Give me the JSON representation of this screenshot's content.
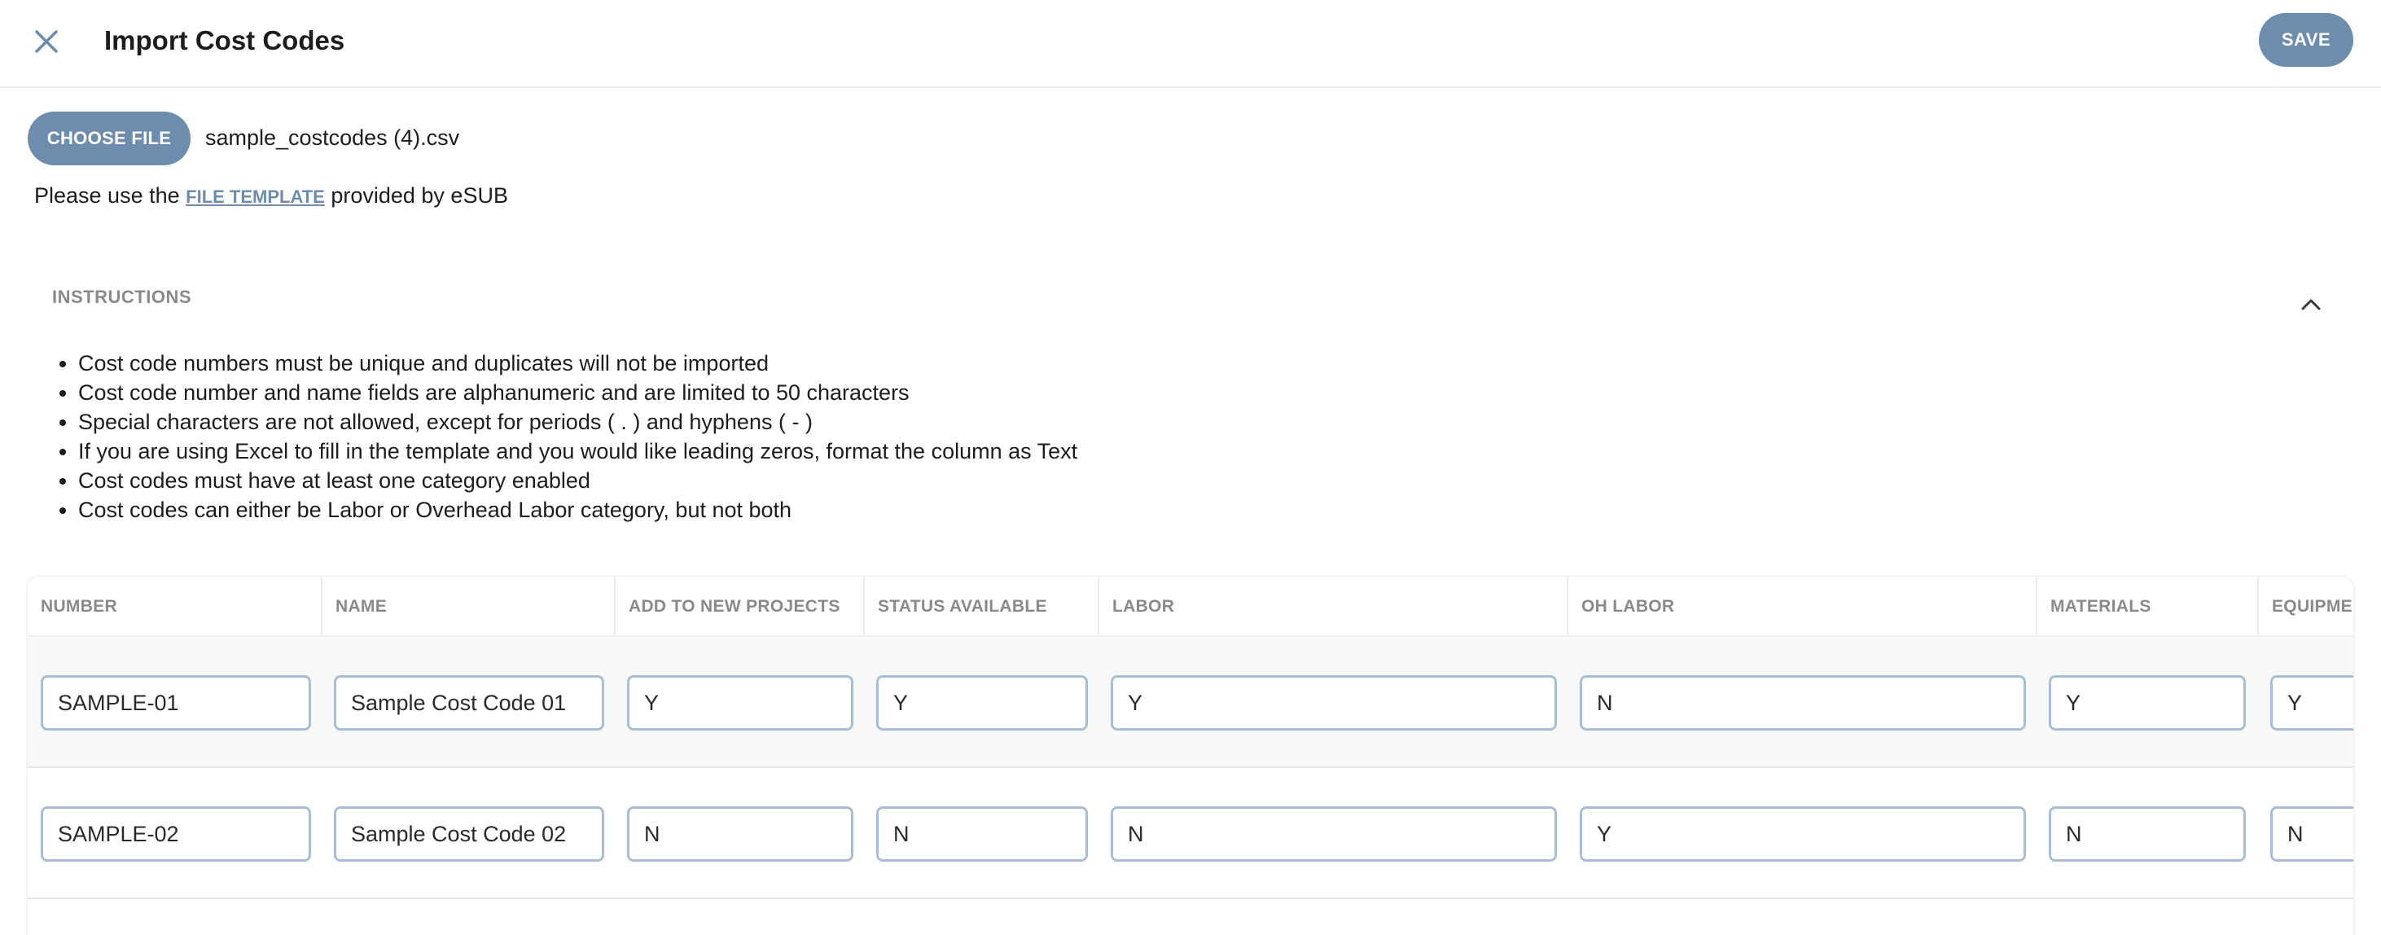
{
  "header": {
    "title": "Import Cost Codes",
    "save_label": "SAVE"
  },
  "file": {
    "choose_label": "CHOOSE FILE",
    "file_name": "sample_costcodes (4).csv"
  },
  "template_note": {
    "prefix": "Please use the ",
    "link_label": "FILE TEMPLATE",
    "suffix": " provided by eSUB"
  },
  "instructions": {
    "heading": "INSTRUCTIONS",
    "items": [
      "Cost code numbers must be unique and duplicates will not be imported",
      "Cost code number and name fields are alphanumeric and are limited to 50 characters",
      "Special characters are not allowed, except for periods ( . ) and hyphens ( - )",
      "If you are using Excel to fill in the template and you would like leading zeros, format the column as Text",
      "Cost codes must have at least one category enabled",
      "Cost codes can either be Labor or Overhead Labor category, but not both"
    ]
  },
  "table": {
    "columns": [
      "NUMBER",
      "NAME",
      "ADD TO NEW PROJECTS",
      "STATUS AVAILABLE",
      "LABOR",
      "OH LABOR",
      "MATERIALS",
      "EQUIPME"
    ],
    "rows": [
      [
        "SAMPLE-01",
        "Sample Cost Code 01",
        "Y",
        "Y",
        "Y",
        "N",
        "Y",
        "Y"
      ],
      [
        "SAMPLE-02",
        "Sample Cost Code 02",
        "N",
        "N",
        "N",
        "Y",
        "N",
        "N"
      ]
    ]
  },
  "icons": {
    "close": "close-icon",
    "collapse": "chevron-up-icon"
  },
  "colors": {
    "accent": "#6e8cae",
    "input_border": "#a9bed6",
    "muted_text": "#8a8a8a"
  }
}
